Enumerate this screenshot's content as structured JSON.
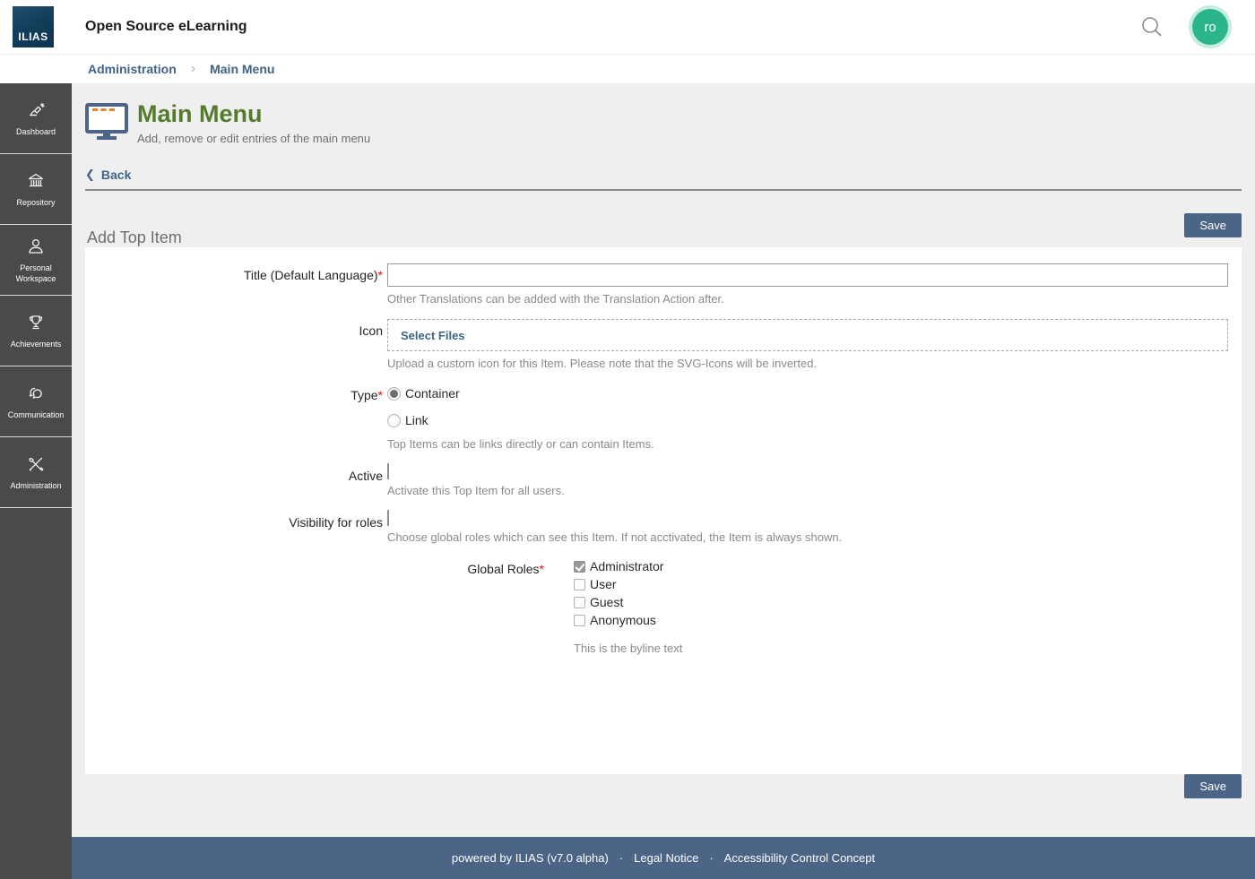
{
  "header": {
    "logo_text": "ILIAS",
    "app_title": "Open Source eLearning",
    "avatar_initials": "ro"
  },
  "breadcrumb": {
    "separator": "›",
    "items": [
      {
        "label": "Administration"
      },
      {
        "label": "Main Menu"
      }
    ]
  },
  "sidebar": {
    "items": [
      {
        "label": "Dashboard",
        "icon": "dashboard-icon"
      },
      {
        "label": "Repository",
        "icon": "repository-icon"
      },
      {
        "label": "Personal Workspace",
        "icon": "personal-workspace-icon"
      },
      {
        "label": "Achievements",
        "icon": "achievements-icon"
      },
      {
        "label": "Communication",
        "icon": "communication-icon"
      },
      {
        "label": "Administration",
        "icon": "administration-icon"
      }
    ]
  },
  "page": {
    "title": "Main Menu",
    "subtitle": "Add, remove or edit entries of the main menu",
    "back_label": "Back",
    "back_chevron": "❮",
    "section_title": "Add Top Item",
    "save_label": "Save"
  },
  "form": {
    "required_marker": "*",
    "title_field": {
      "label": "Title (Default Language)",
      "required": true,
      "value": "",
      "byline": "Other Translations can be added with the Translation Action after."
    },
    "icon_field": {
      "label": "Icon",
      "button_label": "Select Files",
      "byline": "Upload a custom icon for this Item. Please note that the SVG-Icons will be inverted."
    },
    "type_field": {
      "label": "Type",
      "required": true,
      "options": [
        {
          "label": "Container",
          "checked": true
        },
        {
          "label": "Link",
          "checked": false
        }
      ],
      "byline": "Top Items can be links directly or can contain Items."
    },
    "active_field": {
      "label": "Active",
      "checked": true,
      "byline": "Activate this Top Item for all users."
    },
    "visibility_field": {
      "label": "Visibility for roles",
      "checked": true,
      "byline": "Choose global roles which can see this Item. If not acctivated, the Item is always shown."
    },
    "global_roles_field": {
      "label": "Global Roles",
      "required": true,
      "options": [
        {
          "label": "Administrator",
          "checked": true
        },
        {
          "label": "User",
          "checked": false
        },
        {
          "label": "Guest",
          "checked": false
        },
        {
          "label": "Anonymous",
          "checked": false
        }
      ],
      "byline": "This is the byline text"
    }
  },
  "footer": {
    "powered_by": "powered by ILIAS (v7.0 alpha)",
    "separator": "·",
    "links": [
      {
        "label": "Legal Notice"
      },
      {
        "label": "Accessibility Control Concept"
      }
    ]
  },
  "colors": {
    "accent_green_title": "#557b2d",
    "link_blue": "#3f6487",
    "save_button": "#4c6586",
    "footer_bg": "#4c6586",
    "sidebar_bg": "#4a4a4a",
    "avatar_green": "#2bb58b",
    "content_bg": "#efefef",
    "icon_orange": "#e8832e"
  }
}
